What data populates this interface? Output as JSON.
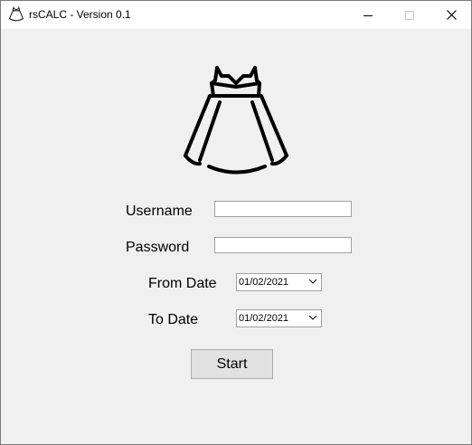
{
  "window": {
    "title": "rsCALC - Version 0.1",
    "app_icon": "dress-icon",
    "controls": [
      "minimize-icon",
      "maximize-icon",
      "close-icon"
    ]
  },
  "logo": {
    "icon": "dress-icon"
  },
  "form": {
    "username_label": "Username",
    "username_value": "",
    "password_label": "Password",
    "password_value": "",
    "from_date_label": "From Date",
    "from_date_value": "01/02/2021",
    "to_date_label": "To Date",
    "to_date_value": "01/02/2021",
    "start_label": "Start"
  }
}
